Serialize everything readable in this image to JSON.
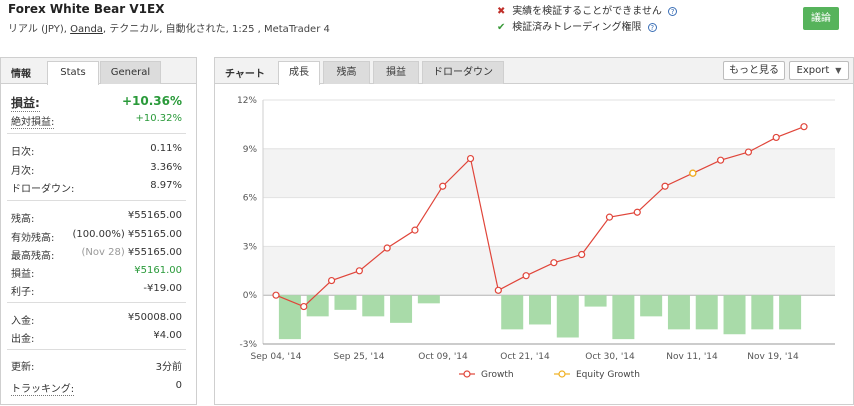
{
  "header": {
    "title": "Forex White Bear V1EX",
    "sub_prefix": "リアル (JPY), ",
    "broker": "Oanda",
    "sub_suffix": ", テクニカル, 自動化された, 1:25 , MetaTrader 4",
    "verify_fail": "実績を検証することができません",
    "verify_ok": "検証済みトレーディング権限",
    "discuss_button": "議論"
  },
  "left": {
    "label": "情報",
    "tabs": [
      "Stats",
      "General"
    ],
    "rows": {
      "gain_label": "損益:",
      "gain_value": "+10.36%",
      "abs_gain_label": "絶対損益:",
      "abs_gain_value": "+10.32%",
      "daily_label": "日次:",
      "daily_value": "0.11%",
      "monthly_label": "月次:",
      "monthly_value": "3.36%",
      "drawdown_label": "ドローダウン:",
      "drawdown_value": "8.97%",
      "balance_label": "残高:",
      "balance_value": "¥55165.00",
      "equity_label": "有効残高:",
      "equity_note": "(100.00%)",
      "equity_value": "¥55165.00",
      "highest_label": "最高残高:",
      "highest_note": "(Nov 28)",
      "highest_value": "¥55165.00",
      "profit_label": "損益:",
      "profit_value": "¥5161.00",
      "interest_label": "利子:",
      "interest_value": "-¥19.00",
      "deposit_label": "入金:",
      "deposit_value": "¥50008.00",
      "withdraw_label": "出金:",
      "withdraw_value": "¥4.00",
      "updated_label": "更新:",
      "updated_value": "3分前",
      "tracking_label": "トラッキング:",
      "tracking_value": "0"
    }
  },
  "right": {
    "label": "チャート",
    "tabs": [
      "成長",
      "残高",
      "損益",
      "ドローダウン"
    ],
    "more_button": "もっと見る",
    "export_button": "Export"
  },
  "colors": {
    "growth": "#e0453a",
    "equity": "#f0b020",
    "bars": "#a9dba9",
    "accent": "#56b35b"
  },
  "chart_data": {
    "type": "line",
    "xlabels": [
      "Sep 04, '14",
      "Sep 25, '14",
      "Oct 09, '14",
      "Oct 21, '14",
      "Oct 30, '14",
      "Nov 11, '14",
      "Nov 19, '14"
    ],
    "ytick_labels": [
      "12%",
      "9%",
      "6%",
      "3%",
      "0%",
      "-3%"
    ],
    "ylim": [
      -3,
      12
    ],
    "series": [
      {
        "name": "Growth",
        "values": [
          0.0,
          -0.7,
          0.9,
          1.5,
          2.9,
          4.0,
          6.7,
          8.4,
          0.3,
          1.2,
          2.0,
          2.5,
          4.8,
          5.1,
          6.7,
          7.5,
          8.3,
          8.8,
          9.7,
          10.36
        ]
      },
      {
        "name": "Equity Growth",
        "values": [
          null,
          null,
          null,
          null,
          null,
          null,
          null,
          null,
          null,
          null,
          null,
          null,
          null,
          null,
          null,
          7.5,
          null,
          null,
          null,
          null
        ]
      }
    ],
    "bars": [
      -2.7,
      -1.3,
      -0.9,
      -1.3,
      -1.7,
      -0.5,
      0.0,
      0.0,
      -2.1,
      -1.8,
      -2.6,
      -0.7,
      -2.7,
      -1.3,
      -2.1,
      -2.1,
      -2.4,
      -2.1,
      -2.1
    ],
    "legend": [
      "Growth",
      "Equity Growth"
    ],
    "legend_position": "bottom"
  }
}
